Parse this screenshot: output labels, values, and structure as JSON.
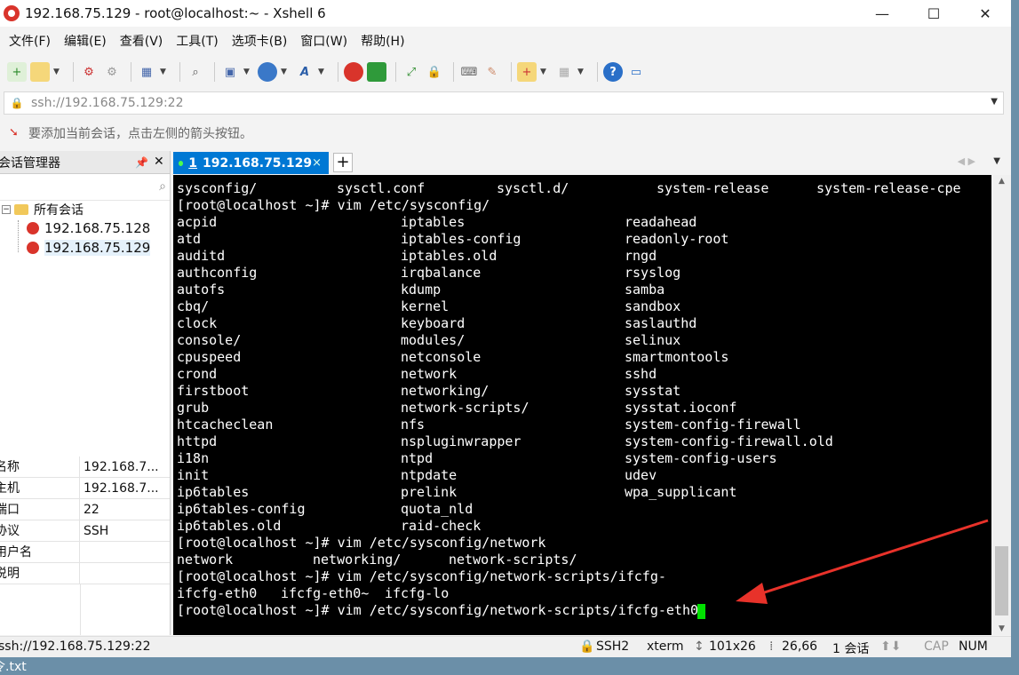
{
  "window": {
    "title": "192.168.75.129 - root@localhost:~ - Xshell 6"
  },
  "window_controls": {
    "minimize": "—",
    "maximize": "☐",
    "close": "✕"
  },
  "menu": [
    "文件(F)",
    "编辑(E)",
    "查看(V)",
    "工具(T)",
    "选项卡(B)",
    "窗口(W)",
    "帮助(H)"
  ],
  "address": {
    "value": "ssh://192.168.75.129:22"
  },
  "hint": {
    "text": "要添加当前会话，点击左侧的箭头按钮。"
  },
  "sidebar": {
    "title": "会话管理器",
    "pin": "ᵖ",
    "close": "✕",
    "tree": {
      "root": "所有会话",
      "items": [
        "192.168.75.128",
        "192.168.75.129"
      ]
    },
    "props": [
      {
        "key": "名称",
        "value": "192.168.7..."
      },
      {
        "key": "主机",
        "value": "192.168.7..."
      },
      {
        "key": "端口",
        "value": "22"
      },
      {
        "key": "协议",
        "value": "SSH"
      },
      {
        "key": "用户名",
        "value": ""
      },
      {
        "key": "说明",
        "value": ""
      }
    ]
  },
  "tab": {
    "number": "1",
    "label": "192.168.75.129",
    "close": "×",
    "add": "+"
  },
  "terminal": {
    "top_line": [
      "sysconfig/",
      "sysctl.conf",
      "sysctl.d/",
      "system-release",
      "system-release-cpe"
    ],
    "cmd1": "[root@localhost ~]# vim /etc/sysconfig/",
    "columns": [
      [
        "acpid",
        "atd",
        "auditd",
        "authconfig",
        "autofs",
        "cbq/",
        "clock",
        "console/",
        "cpuspeed",
        "crond",
        "firstboot",
        "grub",
        "htcacheclean",
        "httpd",
        "i18n",
        "init",
        "ip6tables",
        "ip6tables-config",
        "ip6tables.old"
      ],
      [
        "iptables",
        "iptables-config",
        "iptables.old",
        "irqbalance",
        "kdump",
        "kernel",
        "keyboard",
        "modules/",
        "netconsole",
        "network",
        "networking/",
        "network-scripts/",
        "nfs",
        "nspluginwrapper",
        "ntpd",
        "ntpdate",
        "prelink",
        "quota_nld",
        "raid-check"
      ],
      [
        "readahead",
        "readonly-root",
        "rngd",
        "rsyslog",
        "samba",
        "sandbox",
        "saslauthd",
        "selinux",
        "smartmontools",
        "sshd",
        "sysstat",
        "sysstat.ioconf",
        "system-config-firewall",
        "system-config-firewall.old",
        "system-config-users",
        "udev",
        "wpa_supplicant"
      ]
    ],
    "cmd2": "[root@localhost ~]# vim /etc/sysconfig/network",
    "completion2": [
      "network",
      "networking/",
      "network-scripts/"
    ],
    "cmd3": "[root@localhost ~]# vim /etc/sysconfig/network-scripts/ifcfg-",
    "completion3": [
      "ifcfg-eth0",
      "ifcfg-eth0~",
      "ifcfg-lo"
    ],
    "cmd4": "[root@localhost ~]# vim /etc/sysconfig/network-scripts/ifcfg-eth0"
  },
  "status": {
    "address": "ssh://192.168.75.129:22",
    "protocol": "SSH2",
    "term": "xterm",
    "size": "101x26",
    "position": "26,66",
    "sessions": "1 会话",
    "cap": "CAP",
    "num": "NUM"
  },
  "desktop": {
    "file_label": "令.txt"
  },
  "colors": {
    "accent": "#0078d4",
    "cursor": "#00e000",
    "arrow": "#e8322a"
  }
}
